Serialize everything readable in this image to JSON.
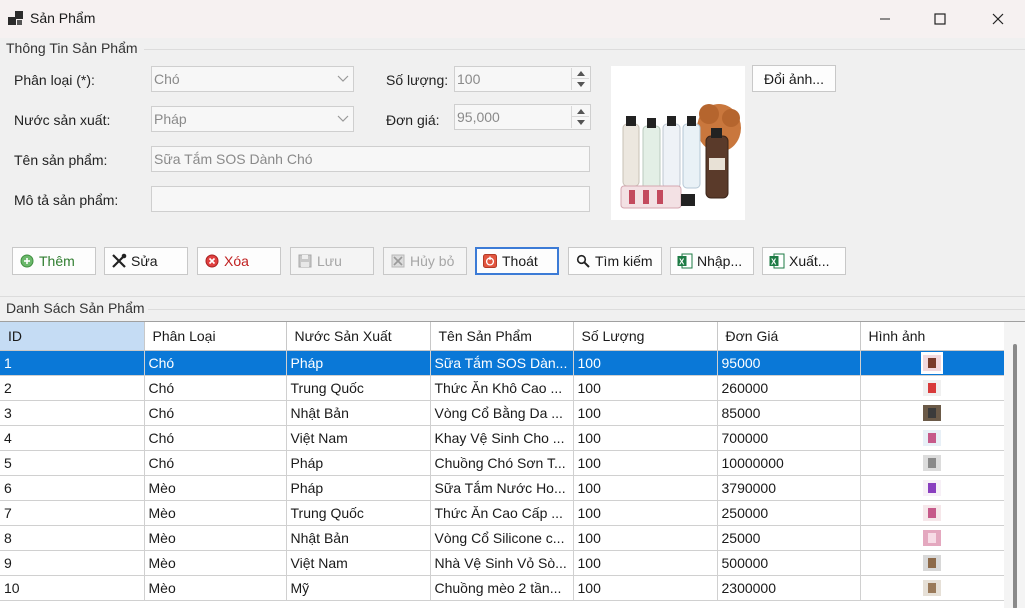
{
  "window": {
    "title": "Sản Phẩm"
  },
  "info_group": {
    "title": "Thông Tin Sản Phẩm",
    "category": {
      "label": "Phân loại (*):",
      "value": "Chó"
    },
    "country": {
      "label": "Nước sản xuất:",
      "value": "Pháp"
    },
    "name": {
      "label": "Tên sản phẩm:",
      "value": "Sữa Tắm SOS Dành Chó"
    },
    "description": {
      "label": "Mô tả sản phẩm:",
      "value": ""
    },
    "quantity": {
      "label": "Số lượng:",
      "value": "100"
    },
    "price": {
      "label": "Đơn giá:",
      "value": "95,000"
    },
    "change_photo_label": "Đổi ảnh..."
  },
  "toolbar": {
    "add": "Thêm",
    "edit": "Sửa",
    "delete": "Xóa",
    "save": "Lưu",
    "cancel": "Hủy bỏ",
    "exit": "Thoát",
    "search": "Tìm kiếm",
    "import": "Nhập...",
    "export": "Xuất..."
  },
  "list_group": {
    "title": "Danh Sách Sản Phẩm"
  },
  "table": {
    "columns": [
      "ID",
      "Phân Loại",
      "Nước Sản Xuất",
      "Tên Sản Phẩm",
      "Số Lượng",
      "Đơn Giá",
      "Hình ảnh"
    ],
    "rows": [
      [
        "1",
        "Chó",
        "Pháp",
        "Sữa Tắm SOS Dàn...",
        "100",
        "95000"
      ],
      [
        "2",
        "Chó",
        "Trung Quốc",
        "Thức Ăn Khô Cao ...",
        "100",
        "260000"
      ],
      [
        "3",
        "Chó",
        "Nhật Bản",
        "Vòng Cổ Bằng Da ...",
        "100",
        "85000"
      ],
      [
        "4",
        "Chó",
        "Việt Nam",
        "Khay Vệ Sinh Cho ...",
        "100",
        "700000"
      ],
      [
        "5",
        "Chó",
        "Pháp",
        "Chuồng Chó Sơn T...",
        "100",
        "10000000"
      ],
      [
        "6",
        "Mèo",
        "Pháp",
        "Sữa Tắm Nước Ho...",
        "100",
        "3790000"
      ],
      [
        "7",
        "Mèo",
        "Trung Quốc",
        "Thức Ăn Cao Cấp ...",
        "100",
        "250000"
      ],
      [
        "8",
        "Mèo",
        "Nhật Bản",
        "Vòng Cổ Silicone c...",
        "100",
        "25000"
      ],
      [
        "9",
        "Mèo",
        "Việt Nam",
        "Nhà Vệ Sinh Vỏ Sò...",
        "100",
        "500000"
      ],
      [
        "10",
        "Mèo",
        "Mỹ",
        "Chuồng mèo 2 tần...",
        "100",
        "2300000"
      ]
    ]
  },
  "colors": {
    "selection": "#0a78d7",
    "header_selected": "#c5dcf4",
    "focus_border": "#3c7bd6"
  }
}
